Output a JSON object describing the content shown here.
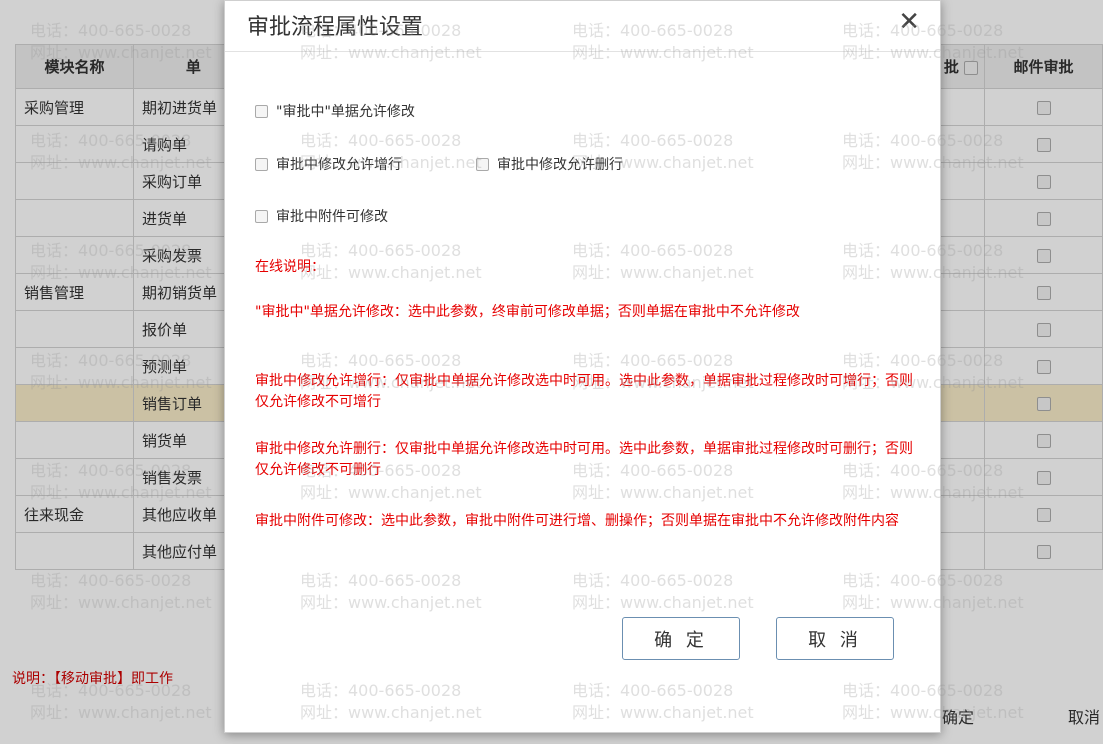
{
  "background": {
    "columns": [
      "模块名称",
      "单",
      "批",
      "邮件审批"
    ],
    "rows": [
      {
        "module": "采购管理",
        "doc": "期初进货单"
      },
      {
        "module": "",
        "doc": "请购单"
      },
      {
        "module": "",
        "doc": "采购订单"
      },
      {
        "module": "",
        "doc": "进货单"
      },
      {
        "module": "",
        "doc": "采购发票"
      },
      {
        "module": "销售管理",
        "doc": "期初销货单"
      },
      {
        "module": "",
        "doc": "报价单"
      },
      {
        "module": "",
        "doc": "预测单"
      },
      {
        "module": "",
        "doc": "销售订单"
      },
      {
        "module": "",
        "doc": "销货单"
      },
      {
        "module": "",
        "doc": "销售发票"
      },
      {
        "module": "往来现金",
        "doc": "其他应收单"
      },
      {
        "module": "",
        "doc": "其他应付单"
      }
    ],
    "selected_row_index": 8,
    "note": "说明：【移动审批】即工作",
    "confirm": "确定",
    "cancel": "取消"
  },
  "watermark": {
    "phone": "电话：400-665-0028",
    "site": "网址：www.chanjet.net"
  },
  "dialog": {
    "title": "审批流程属性设置",
    "close_icon": "close-icon",
    "options": {
      "allow_modify": "\"审批中\"单据允许修改",
      "allow_add_row": "审批中修改允许增行",
      "allow_delete_row": "审批中修改允许删行",
      "attachment_modify": "审批中附件可修改"
    },
    "notes": {
      "heading": "在线说明：",
      "n1": "\"审批中\"单据允许修改：选中此参数，终审前可修改单据；否则单据在审批中不允许修改",
      "n2": "审批中修改允许增行：仅审批中单据允许修改选中时可用。选中此参数，单据审批过程修改时可增行；否则仅允许修改不可增行",
      "n3": "审批中修改允许删行：仅审批中单据允许修改选中时可用。选中此参数，单据审批过程修改时可删行；否则仅允许修改不可删行",
      "n4": "审批中附件可修改：选中此参数，审批中附件可进行增、删操作；否则单据在审批中不允许修改附件内容"
    },
    "confirm": "确 定",
    "cancel": "取 消"
  }
}
